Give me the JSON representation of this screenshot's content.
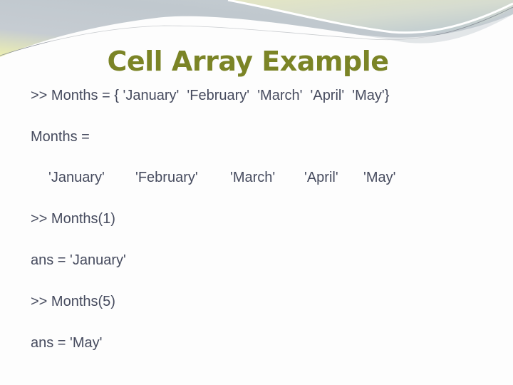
{
  "slide": {
    "title": "Cell Array Example",
    "colors": {
      "title": "#7b8426",
      "body_text": "#464b5e",
      "banner_gray": "#c2cad0",
      "banner_yellow": "#e6e8b8"
    },
    "lines": {
      "assignment": ">> Months = { 'January'  'February'  'March'  'April'  'May'}",
      "output_label": "Months =",
      "command_1": ">> Months(1)",
      "result_1": "ans = 'January'",
      "command_2": ">> Months(5)",
      "result_2": "ans = 'May'"
    },
    "cell_values": [
      "'January'",
      "'February'",
      "'March'",
      "'April'",
      "'May'"
    ]
  }
}
